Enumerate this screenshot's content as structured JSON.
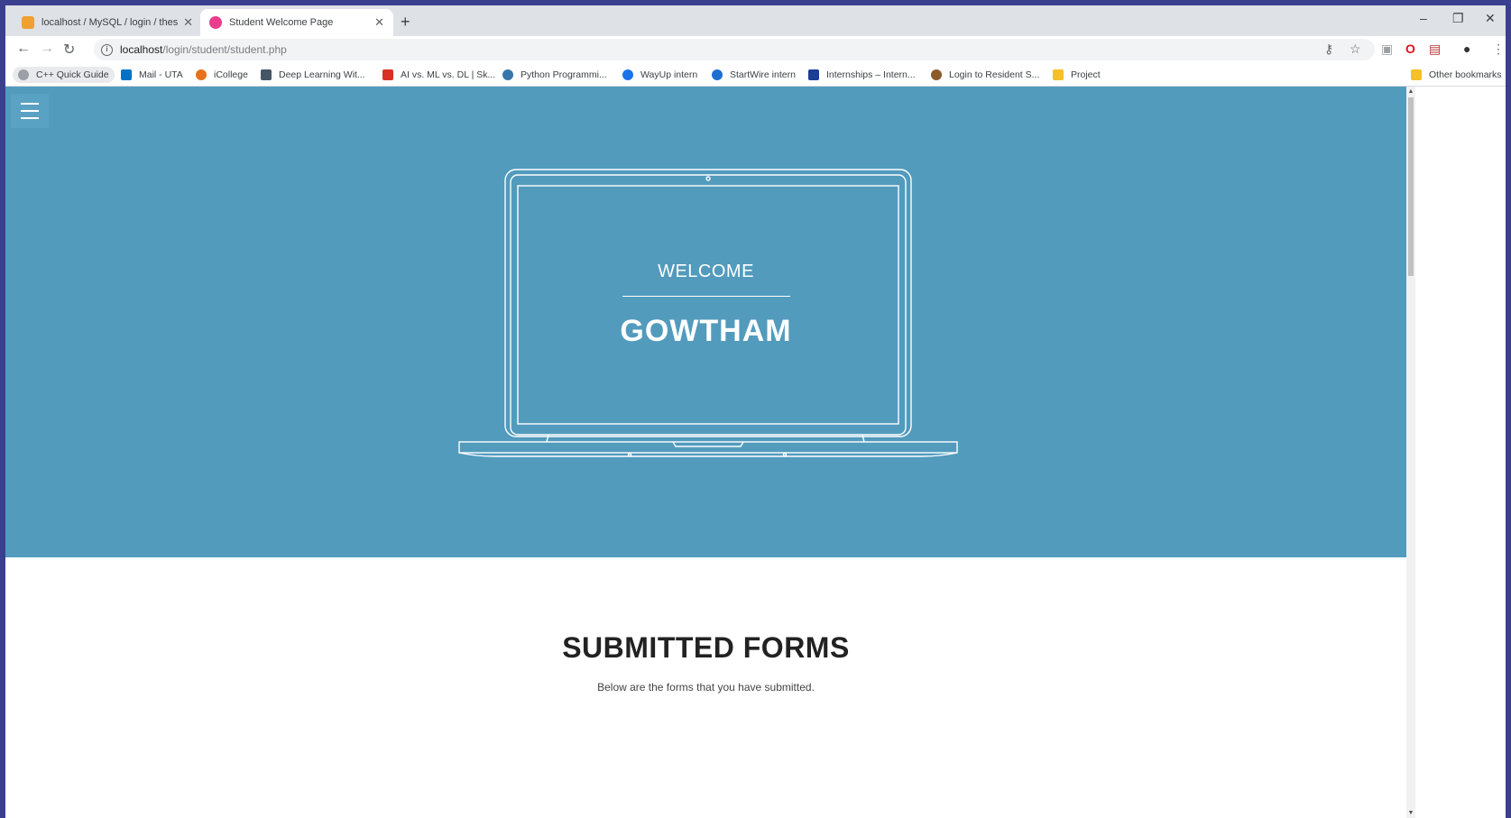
{
  "browser": {
    "tabs": [
      {
        "title": "localhost / MySQL / login / thesis",
        "active": false
      },
      {
        "title": "Student Welcome Page",
        "active": true
      }
    ],
    "new_tab_label": "+",
    "url_host": "localhost",
    "url_path": "/login/student/student.php"
  },
  "bookmarks": [
    {
      "label": "C++ Quick Guide",
      "icon_color": "#5f6368"
    },
    {
      "label": "Mail - UTA",
      "icon_color": "#0072c6"
    },
    {
      "label": "iCollege",
      "icon_color": "#e8711a"
    },
    {
      "label": "Deep Learning Wit...",
      "icon_color": "#445566"
    },
    {
      "label": "AI vs. ML vs. DL | Sk...",
      "icon_color": "#d93025"
    },
    {
      "label": "Python Programmi...",
      "icon_color": "#3776ab"
    },
    {
      "label": "WayUp intern",
      "icon_color": "#1a73e8"
    },
    {
      "label": "StartWire intern",
      "icon_color": "#1f6fd1"
    },
    {
      "label": "Internships – Intern...",
      "icon_color": "#1c3f94"
    },
    {
      "label": "Login to Resident S...",
      "icon_color": "#8a5a2b"
    },
    {
      "label": "Project",
      "icon_color": "#f6c026"
    },
    {
      "label": "Other bookmarks",
      "icon_color": "#f6c026"
    }
  ],
  "hero": {
    "welcome": "WELCOME",
    "name": "GOWTHAM",
    "bg_color": "#529bbd"
  },
  "forms": {
    "title": "SUBMITTED FORMS",
    "subtitle": "Below are the forms that you have submitted."
  }
}
